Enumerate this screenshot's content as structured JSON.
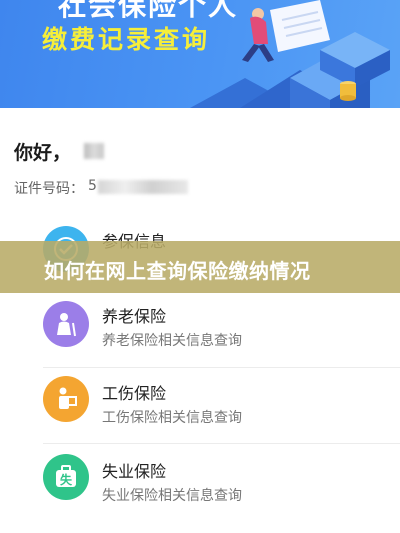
{
  "banner": {
    "title_partial": "社会保险个人",
    "subtitle": "缴费记录查询"
  },
  "user": {
    "greeting": "你好，",
    "id_label": "证件号码：",
    "id_first_char": "5"
  },
  "items": [
    {
      "title": "参保信息",
      "subtitle": "",
      "icon": "shield-icon",
      "color": "#3db4ee"
    },
    {
      "title": "养老保险",
      "subtitle": "养老保险相关信息查询",
      "icon": "elderly-person-icon",
      "color": "#9b7ee8"
    },
    {
      "title": "工伤保险",
      "subtitle": "工伤保险相关信息查询",
      "icon": "injured-worker-icon",
      "color": "#f4a531"
    },
    {
      "title": "失业保险",
      "subtitle": "失业保险相关信息查询",
      "icon": "unemployment-briefcase-icon",
      "color": "#2fc48a",
      "icon_text": "失"
    }
  ],
  "overlay": {
    "title": "如何在网上查询保险缴纳情况"
  },
  "colors": {
    "banner_blue": "#4b95f4",
    "subtitle_yellow": "#f6ee3a",
    "overlay_band": "#b8ab66"
  }
}
